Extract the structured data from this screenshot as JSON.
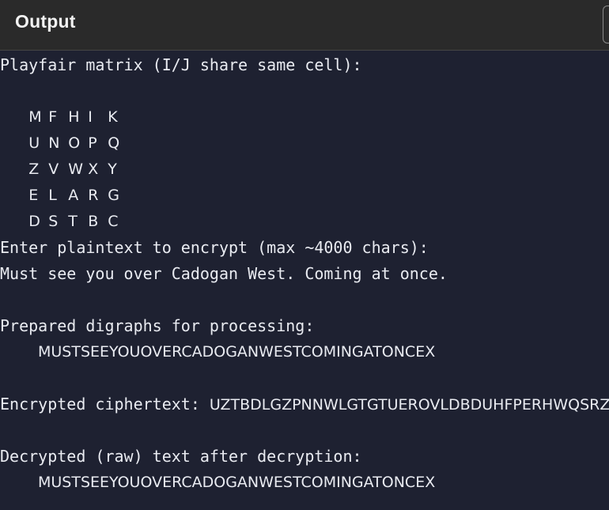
{
  "header": {
    "title": "Output"
  },
  "output": {
    "matrix_heading": "Playfair matrix (I/J share same cell):",
    "matrix_rows": [
      [
        "M",
        "F",
        "H",
        "I",
        "K"
      ],
      [
        "U",
        "N",
        "O",
        "P",
        "Q"
      ],
      [
        "Z",
        "V",
        "W",
        "X",
        "Y"
      ],
      [
        "E",
        "L",
        "A",
        "R",
        "G"
      ],
      [
        "D",
        "S",
        "T",
        "B",
        "C"
      ]
    ],
    "prompt_line": "Enter plaintext to encrypt (max ~4000 chars):",
    "plaintext": "Must see you over Cadogan West. Coming at once.",
    "digraphs_heading": "Prepared digraphs for processing:",
    "digraphs": "MUSTSEEYOUOVERCADOGANWESTCOMINGATONCEX",
    "ciphertext_label": "Encrypted ciphertext: ",
    "ciphertext": "UZTBDLGZPNNWLGTGTUEROVLDBDUHFPERHWQSRZ",
    "decrypted_heading": "Decrypted (raw) text after decryption:",
    "decrypted": "MUSTSEEYOUOVERCADOGANWESTCOMINGATONCEX"
  }
}
